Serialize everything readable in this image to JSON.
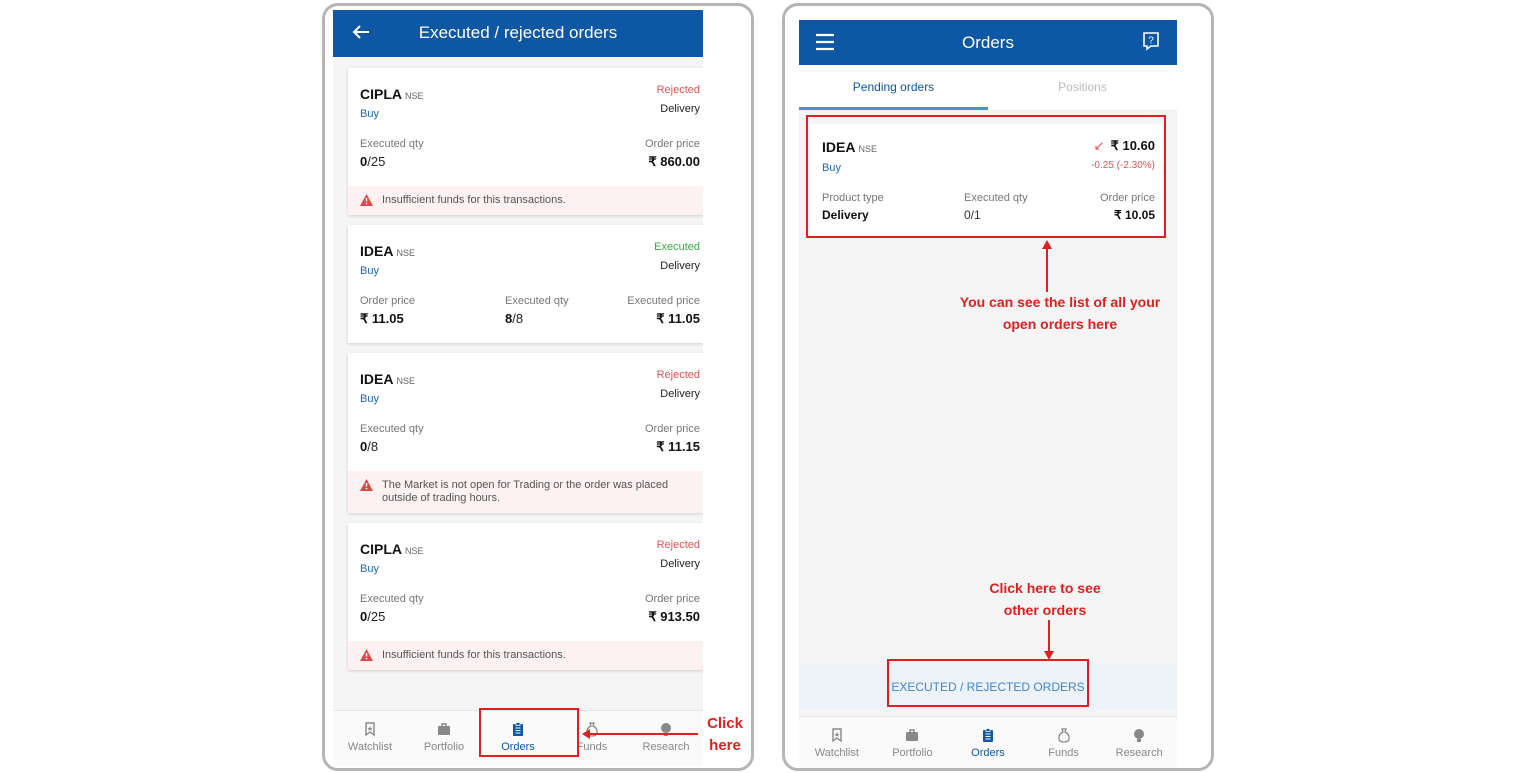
{
  "left": {
    "title": "Executed / rejected orders",
    "orders": [
      {
        "stock": "CIPLA",
        "exchange": "NSE",
        "side": "Buy",
        "status": "Rejected",
        "status_type": "rejected",
        "product": "Delivery",
        "fields": [
          {
            "label": "Executed qty",
            "value_main": "0",
            "value_rest": "/25",
            "pos": "l"
          },
          {
            "label": "Order price",
            "value_main": "₹ 860.00",
            "value_rest": "",
            "pos": "r"
          }
        ],
        "error": "Insufficient funds for this transactions."
      },
      {
        "stock": "IDEA",
        "exchange": "NSE",
        "side": "Buy",
        "status": "Executed",
        "status_type": "executed",
        "product": "Delivery",
        "fields": [
          {
            "label": "Order price",
            "value_main": "₹ 11.05",
            "value_rest": "",
            "pos": "l"
          },
          {
            "label": "Executed qty",
            "value_main": "8",
            "value_rest": "/8",
            "pos": "m"
          },
          {
            "label": "Executed price",
            "value_main": "₹ 11.05",
            "value_rest": "",
            "pos": "r"
          }
        ],
        "error": ""
      },
      {
        "stock": "IDEA",
        "exchange": "NSE",
        "side": "Buy",
        "status": "Rejected",
        "status_type": "rejected",
        "product": "Delivery",
        "fields": [
          {
            "label": "Executed qty",
            "value_main": "0",
            "value_rest": "/8",
            "pos": "l"
          },
          {
            "label": "Order price",
            "value_main": "₹ 11.15",
            "value_rest": "",
            "pos": "r"
          }
        ],
        "error": "The Market is not open for Trading or the order was placed outside of trading hours."
      },
      {
        "stock": "CIPLA",
        "exchange": "NSE",
        "side": "Buy",
        "status": "Rejected",
        "status_type": "rejected",
        "product": "Delivery",
        "fields": [
          {
            "label": "Executed qty",
            "value_main": "0",
            "value_rest": "/25",
            "pos": "l"
          },
          {
            "label": "Order price",
            "value_main": "₹ 913.50",
            "value_rest": "",
            "pos": "r"
          }
        ],
        "error": "Insufficient funds for this transactions."
      }
    ],
    "nav": [
      {
        "label": "Watchlist",
        "icon": "bookmark-icon",
        "active": false
      },
      {
        "label": "Portfolio",
        "icon": "briefcase-icon",
        "active": false
      },
      {
        "label": "Orders",
        "icon": "clipboard-icon",
        "active": true
      },
      {
        "label": "Funds",
        "icon": "money-bag-icon",
        "active": false
      },
      {
        "label": "Research",
        "icon": "bulb-icon",
        "active": false
      }
    ],
    "annotation": "Click\nhere"
  },
  "right": {
    "title": "Orders",
    "tabs": [
      {
        "label": "Pending orders",
        "active": true
      },
      {
        "label": "Positions",
        "active": false
      }
    ],
    "pending": {
      "stock": "IDEA",
      "exchange": "NSE",
      "side": "Buy",
      "ltp": "₹ 10.60",
      "ltp_arrow": "↙",
      "change": "-0.25 (-2.30%)",
      "product_label": "Product type",
      "product": "Delivery",
      "qty_label": "Executed qty",
      "qty": "0/1",
      "price_label": "Order price",
      "price": "₹ 10.05"
    },
    "exec_link": "EXECUTED / REJECTED ORDERS",
    "annotation_list": "You can see the list of all your open orders here",
    "annotation_click": "Click here to see other orders",
    "nav": [
      {
        "label": "Watchlist",
        "icon": "bookmark-icon",
        "active": false
      },
      {
        "label": "Portfolio",
        "icon": "briefcase-icon",
        "active": false
      },
      {
        "label": "Orders",
        "icon": "clipboard-icon",
        "active": true
      },
      {
        "label": "Funds",
        "icon": "money-bag-icon",
        "active": false
      },
      {
        "label": "Research",
        "icon": "bulb-icon",
        "active": false
      }
    ]
  },
  "colors": {
    "appbar": "#0d57a4",
    "annotation": "#e02020",
    "rejected": "#e05252",
    "executed": "#39a845"
  }
}
